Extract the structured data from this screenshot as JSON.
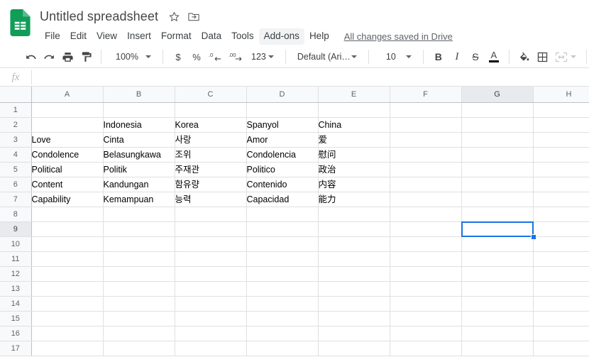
{
  "app": {
    "logo_icon": "google-sheets-logo-icon",
    "doc_title": "Untitled spreadsheet",
    "star_icon": "star-outline-icon",
    "move_folder_icon": "move-to-folder-icon",
    "accent_color": "#1a73e8",
    "brand_color": "#0f9d58"
  },
  "menu": {
    "items": [
      {
        "label": "File",
        "active": false
      },
      {
        "label": "Edit",
        "active": false
      },
      {
        "label": "View",
        "active": false
      },
      {
        "label": "Insert",
        "active": false
      },
      {
        "label": "Format",
        "active": false
      },
      {
        "label": "Data",
        "active": false
      },
      {
        "label": "Tools",
        "active": false
      },
      {
        "label": "Add-ons",
        "active": true
      },
      {
        "label": "Help",
        "active": false
      }
    ],
    "save_status": "All changes saved in Drive"
  },
  "toolbar": {
    "undo_icon": "undo-icon",
    "redo_icon": "redo-icon",
    "print_icon": "print-icon",
    "paint_format_icon": "paint-format-icon",
    "zoom_value": "100%",
    "currency_label": "$",
    "percent_label": "%",
    "decrease_decimal_label": ".0",
    "increase_decimal_label": ".00",
    "number_format_label": "123",
    "font_name": "Default (Ari…",
    "font_size": "10",
    "bold_label": "B",
    "italic_label": "I",
    "strikethrough_label": "S",
    "text_color_label": "A",
    "text_color_value": "#000000",
    "fill_color_icon": "fill-color-icon",
    "borders_icon": "borders-icon",
    "merge_cells_icon": "merge-cells-icon",
    "align_icon": "horizontal-align-icon"
  },
  "formula_bar": {
    "fx_label": "fx",
    "value": "",
    "placeholder": ""
  },
  "grid": {
    "columns": [
      "A",
      "B",
      "C",
      "D",
      "E",
      "F",
      "G",
      "H"
    ],
    "rows": [
      1,
      2,
      3,
      4,
      5,
      6,
      7,
      8,
      9,
      10,
      11,
      12,
      13,
      14,
      15,
      16,
      17
    ],
    "selected_cell": "G9",
    "selected_column": "G",
    "selected_row": 9,
    "cells": [
      [
        "",
        "",
        "",
        "",
        "",
        "",
        "",
        ""
      ],
      [
        "",
        "Indonesia",
        "Korea",
        "Spanyol",
        "China",
        "",
        "",
        ""
      ],
      [
        "Love",
        "Cinta",
        "사랑",
        "Amor",
        "爱",
        "",
        "",
        ""
      ],
      [
        "Condolence",
        "Belasungkawa",
        "조위",
        "Condolencia",
        "慰问",
        "",
        "",
        ""
      ],
      [
        "Political",
        "Politik",
        "주재관",
        "Politico",
        "政治",
        "",
        "",
        ""
      ],
      [
        "Content",
        "Kandungan",
        "함유량",
        "Contenido",
        "内容",
        "",
        "",
        ""
      ],
      [
        "Capability",
        "Kemampuan",
        "능력",
        "Capacidad",
        "能力",
        "",
        "",
        ""
      ],
      [
        "",
        "",
        "",
        "",
        "",
        "",
        "",
        ""
      ],
      [
        "",
        "",
        "",
        "",
        "",
        "",
        "",
        ""
      ],
      [
        "",
        "",
        "",
        "",
        "",
        "",
        "",
        ""
      ],
      [
        "",
        "",
        "",
        "",
        "",
        "",
        "",
        ""
      ],
      [
        "",
        "",
        "",
        "",
        "",
        "",
        "",
        ""
      ],
      [
        "",
        "",
        "",
        "",
        "",
        "",
        "",
        ""
      ],
      [
        "",
        "",
        "",
        "",
        "",
        "",
        "",
        ""
      ],
      [
        "",
        "",
        "",
        "",
        "",
        "",
        "",
        ""
      ],
      [
        "",
        "",
        "",
        "",
        "",
        "",
        "",
        ""
      ],
      [
        "",
        "",
        "",
        "",
        "",
        "",
        "",
        ""
      ]
    ]
  }
}
